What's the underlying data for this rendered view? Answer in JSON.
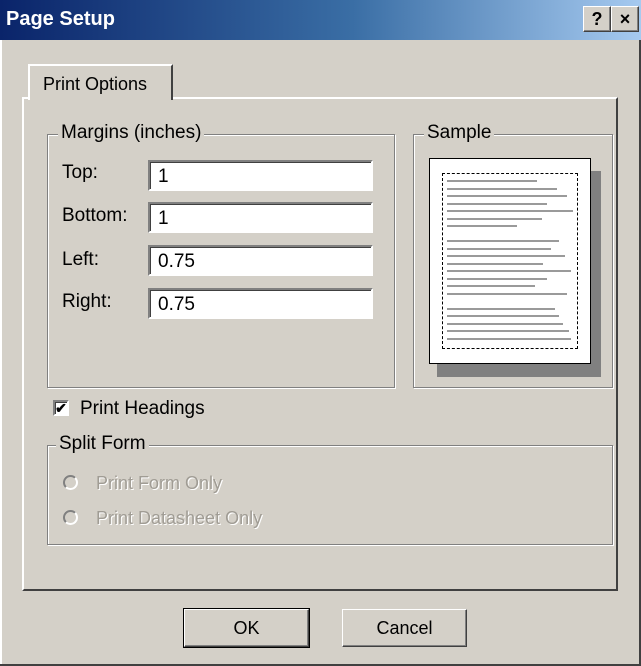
{
  "window": {
    "title": "Page Setup",
    "help_label": "?",
    "close_label": "×"
  },
  "tabs": [
    {
      "label": "Print Options"
    }
  ],
  "margins": {
    "group_label": "Margins (inches)",
    "top": {
      "label": "Top:",
      "value": "1"
    },
    "bottom": {
      "label": "Bottom:",
      "value": "1"
    },
    "left": {
      "label": "Left:",
      "value": "0.75"
    },
    "right": {
      "label": "Right:",
      "value": "0.75"
    }
  },
  "sample": {
    "group_label": "Sample"
  },
  "print_headings": {
    "label": "Print Headings",
    "checked": true,
    "check_glyph": "✔"
  },
  "split_form": {
    "group_label": "Split Form",
    "options": [
      {
        "label": "Print Form Only",
        "enabled": false
      },
      {
        "label": "Print Datasheet Only",
        "enabled": false
      }
    ]
  },
  "buttons": {
    "ok": "OK",
    "cancel": "Cancel"
  }
}
